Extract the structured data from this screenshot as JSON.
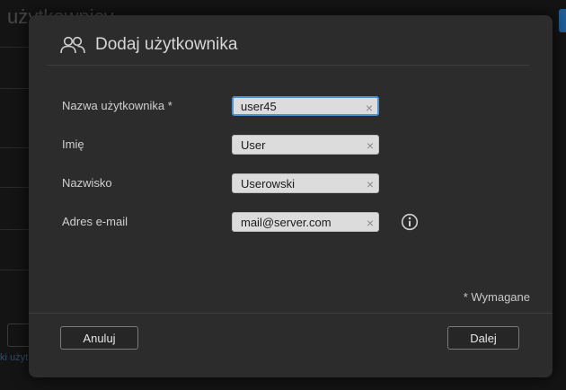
{
  "background": {
    "title": "użytkownicy",
    "link_fragment": "ki użyt"
  },
  "dialog": {
    "title": "Dodaj użytkownika",
    "header_icon": "users-icon",
    "fields": {
      "username": {
        "label": "Nazwa użytkownika *",
        "value": "user45"
      },
      "first_name": {
        "label": "Imię",
        "value": "User"
      },
      "last_name": {
        "label": "Nazwisko",
        "value": "Userowski"
      },
      "email": {
        "label": "Adres e-mail",
        "value": "mail@server.com"
      }
    },
    "clear_glyph": "×",
    "info_icon": "info-icon",
    "required_note": "* Wymagane",
    "buttons": {
      "cancel": "Anuluj",
      "next": "Dalej"
    }
  },
  "colors": {
    "dialog_bg": "#2c2c2c",
    "focus_border": "#4e8fd1",
    "field_bg": "#dcdcdc"
  }
}
